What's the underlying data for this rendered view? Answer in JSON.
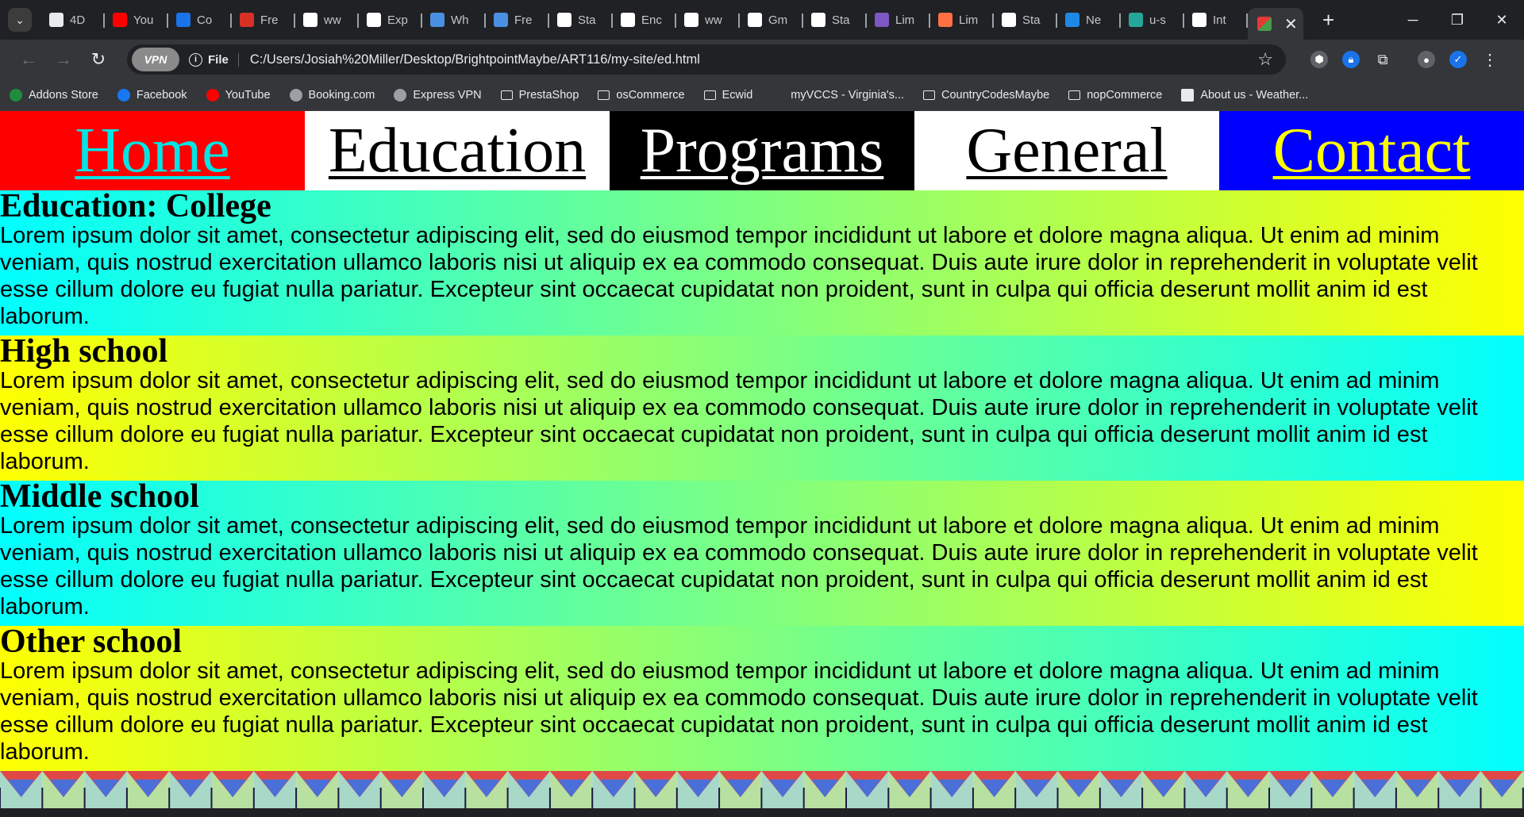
{
  "browser": {
    "tabs": [
      {
        "label": "4D",
        "icon": "4d-icon",
        "color": "#e8eaed"
      },
      {
        "label": "You",
        "icon": "youtube-icon",
        "color": "#ff0000"
      },
      {
        "label": "Co",
        "icon": "calendar-icon",
        "color": "#1a73e8"
      },
      {
        "label": "Fre",
        "icon": "store-icon",
        "color": "#d93025"
      },
      {
        "label": "ww",
        "icon": "search-icon",
        "color": "#ffffff"
      },
      {
        "label": "Exp",
        "icon": "arch-icon",
        "color": "#ffffff"
      },
      {
        "label": "Wh",
        "icon": "arch-icon",
        "color": "#4a90e2"
      },
      {
        "label": "Fre",
        "icon": "arch-icon",
        "color": "#4a90e2"
      },
      {
        "label": "Sta",
        "icon": "search-icon",
        "color": "#ffffff"
      },
      {
        "label": "Enc",
        "icon": "github-icon",
        "color": "#ffffff"
      },
      {
        "label": "ww",
        "icon": "search-icon",
        "color": "#ffffff"
      },
      {
        "label": "Gm",
        "icon": "google-icon",
        "color": "#ffffff"
      },
      {
        "label": "Sta",
        "icon": "search-icon",
        "color": "#ffffff"
      },
      {
        "label": "Lim",
        "icon": "s-icon",
        "color": "#7e57c2"
      },
      {
        "label": "Lim",
        "icon": "pen-icon",
        "color": "#ff7043"
      },
      {
        "label": "Sta",
        "icon": "search-icon",
        "color": "#ffffff"
      },
      {
        "label": "Ne",
        "icon": "aol-icon",
        "color": "#1e88e5"
      },
      {
        "label": "u-s",
        "icon": "shield-icon",
        "color": "#26a69a"
      },
      {
        "label": "Int",
        "icon": "b-icon",
        "color": "#ffffff"
      }
    ],
    "active_tab": {
      "icon": "page-icon",
      "close": "✕"
    },
    "new_tab": "+",
    "window_controls": {
      "minimize": "─",
      "restore": "❐",
      "close": "✕"
    },
    "nav": {
      "back": "←",
      "forward": "→",
      "reload": "↻"
    },
    "vpn_label": "VPN",
    "file_chip": "File",
    "info_glyph": "i",
    "url": "C:/Users/Josiah%20Miller/Desktop/BrightpointMaybe/ART116/my-site/ed.html",
    "bookmark_star": "☆",
    "bookmarks": [
      {
        "label": "Addons Store",
        "icon": "addons-icon",
        "type": "site"
      },
      {
        "label": "Facebook",
        "icon": "facebook-icon",
        "type": "site"
      },
      {
        "label": "YouTube",
        "icon": "youtube-icon",
        "type": "site"
      },
      {
        "label": "Booking.com",
        "icon": "globe-icon",
        "type": "site"
      },
      {
        "label": "Express VPN",
        "icon": "globe-icon",
        "type": "site"
      },
      {
        "label": "PrestaShop",
        "icon": "folder-icon",
        "type": "folder"
      },
      {
        "label": "osCommerce",
        "icon": "folder-icon",
        "type": "folder"
      },
      {
        "label": "Ecwid",
        "icon": "folder-icon",
        "type": "folder"
      },
      {
        "label": "myVCCS - Virginia's...",
        "icon": "moon-icon",
        "type": "site"
      },
      {
        "label": "CountryCodesMaybe",
        "icon": "folder-icon",
        "type": "folder"
      },
      {
        "label": "nopCommerce",
        "icon": "folder-icon",
        "type": "folder"
      },
      {
        "label": "About us - Weather...",
        "icon": "weather-icon",
        "type": "site"
      }
    ]
  },
  "page": {
    "nav": {
      "home": "Home",
      "education": "Education",
      "programs": "Programs",
      "general": "General",
      "contact": "Contact"
    },
    "sections": [
      {
        "heading": "Education: College",
        "body": "Lorem ipsum dolor sit amet, consectetur adipiscing elit, sed do eiusmod tempor incididunt ut labore et dolore magna aliqua. Ut enim ad minim veniam, quis nostrud exercitation ullamco laboris nisi ut aliquip ex ea commodo consequat. Duis aute irure dolor in reprehenderit in voluptate velit esse cillum dolore eu fugiat nulla pariatur. Excepteur sint occaecat cupidatat non proident, sunt in culpa qui officia deserunt mollit anim id est laborum."
      },
      {
        "heading": "High school",
        "body": "Lorem ipsum dolor sit amet, consectetur adipiscing elit, sed do eiusmod tempor incididunt ut labore et dolore magna aliqua. Ut enim ad minim veniam, quis nostrud exercitation ullamco laboris nisi ut aliquip ex ea commodo consequat. Duis aute irure dolor in reprehenderit in voluptate velit esse cillum dolore eu fugiat nulla pariatur. Excepteur sint occaecat cupidatat non proident, sunt in culpa qui officia deserunt mollit anim id est laborum."
      },
      {
        "heading": "Middle school",
        "body": "Lorem ipsum dolor sit amet, consectetur adipiscing elit, sed do eiusmod tempor incididunt ut labore et dolore magna aliqua. Ut enim ad minim veniam, quis nostrud exercitation ullamco laboris nisi ut aliquip ex ea commodo consequat. Duis aute irure dolor in reprehenderit in voluptate velit esse cillum dolore eu fugiat nulla pariatur. Excepteur sint occaecat cupidatat non proident, sunt in culpa qui officia deserunt mollit anim id est laborum."
      },
      {
        "heading": "Other school",
        "body": "Lorem ipsum dolor sit amet, consectetur adipiscing elit, sed do eiusmod tempor incididunt ut labore et dolore magna aliqua. Ut enim ad minim veniam, quis nostrud exercitation ullamco laboris nisi ut aliquip ex ea commodo consequat. Duis aute irure dolor in reprehenderit in voluptate velit esse cillum dolore eu fugiat nulla pariatur. Excepteur sint occaecat cupidatat non proident, sunt in culpa qui officia deserunt mollit anim id est laborum."
      }
    ],
    "colors": {
      "home_bg": "#ff0000",
      "home_text": "#00e5e5",
      "programs_bg": "#000000",
      "contact_bg": "#0000ff",
      "contact_text": "#ffff00",
      "gradient_cyan": "#00ffff",
      "gradient_yellow": "#ffff00"
    }
  }
}
